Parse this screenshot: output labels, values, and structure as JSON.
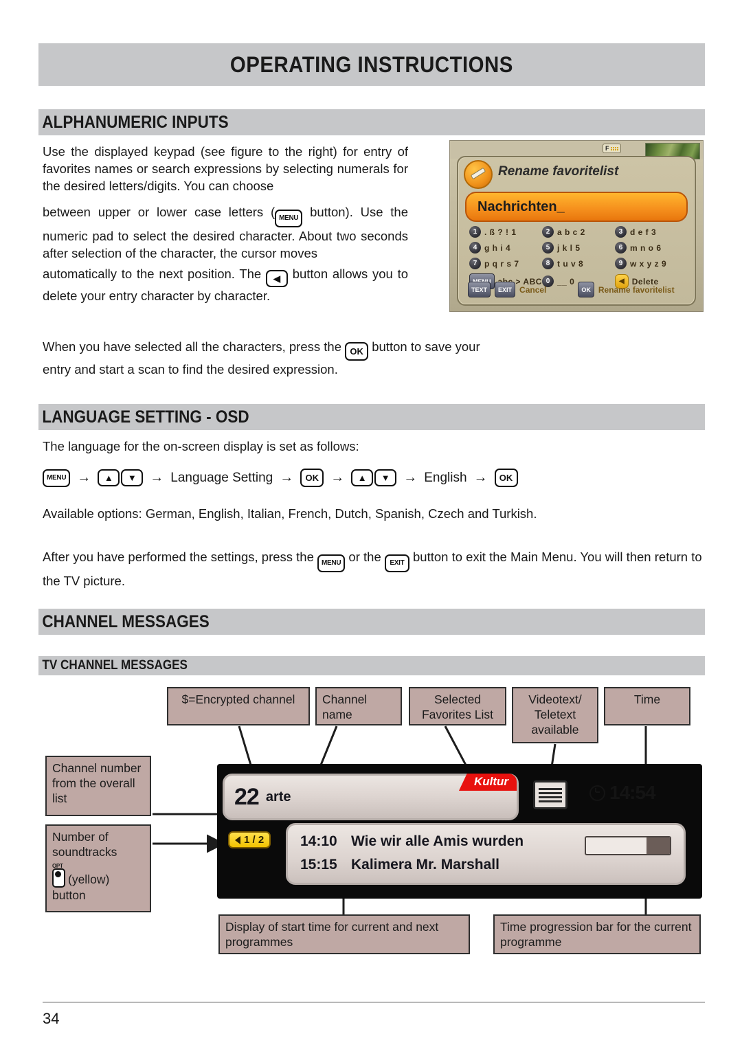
{
  "document": {
    "header_title": "OPERATING INSTRUCTIONS",
    "page_number": "34"
  },
  "sections": {
    "alphanumeric": {
      "heading": "ALPHANUMERIC INPUTS",
      "para1": "Use the displayed keypad (see figure to the right) for entry of favorites names or search expressions by selecting numerals for the desired letters/digits. You can choose",
      "para2_before": "between upper or lower case letters (",
      "para2_key": "MENU",
      "para2_after": " button). Use the numeric pad to select the desired character. About two seconds after selection of the character, the cursor moves",
      "para3_before": "automatically to the next position. The ",
      "para3_key": "◀",
      "para3_after": " button allows you to delete your entry character by character.",
      "para4_before": "When you have selected all the characters, press the ",
      "para4_key": "OK",
      "para4_after": " button to save your entry and start a scan to find the desired expression."
    },
    "language": {
      "heading": "LANGUAGE SETTING - OSD",
      "intro": "The language for the on-screen display is set as follows:",
      "sequence": [
        {
          "type": "key",
          "label": "MENU",
          "style": "menu"
        },
        {
          "type": "arrow",
          "label": "→"
        },
        {
          "type": "keypair",
          "labels": [
            "▲",
            "▼"
          ]
        },
        {
          "type": "arrow",
          "label": "→"
        },
        {
          "type": "text",
          "label": "Language Setting"
        },
        {
          "type": "arrow",
          "label": "→"
        },
        {
          "type": "key",
          "label": "OK",
          "style": "ok"
        },
        {
          "type": "arrow",
          "label": "→"
        },
        {
          "type": "keypair",
          "labels": [
            "▲",
            "▼"
          ]
        },
        {
          "type": "arrow",
          "label": "→"
        },
        {
          "type": "text",
          "label": "English"
        },
        {
          "type": "arrow",
          "label": "→"
        },
        {
          "type": "key",
          "label": "OK",
          "style": "ok"
        }
      ],
      "options": "Available options: German, English, Italian, French, Dutch, Spanish, Czech and Turkish.",
      "exit_before": "After you have performed the settings, press the ",
      "exit_key1": "MENU",
      "exit_mid": " or the ",
      "exit_key2": "EXIT",
      "exit_after": " button to exit the Main Menu. You will then return to the TV picture."
    },
    "channel_messages": {
      "heading": "CHANNEL MESSAGES",
      "subheading": "TV CHANNEL MESSAGES"
    }
  },
  "keypad_figure": {
    "title": "Rename favoritelist",
    "input_value": "Nachrichten_",
    "f_badge": "F",
    "keys": [
      {
        "btn": "1",
        "label": ". ß ? ! 1"
      },
      {
        "btn": "2",
        "label": "a b c 2"
      },
      {
        "btn": "3",
        "label": "d e f 3"
      },
      {
        "btn": "4",
        "label": "g h i 4"
      },
      {
        "btn": "5",
        "label": "j k l 5"
      },
      {
        "btn": "6",
        "label": "m n o 6"
      },
      {
        "btn": "7",
        "label": "p q r s 7"
      },
      {
        "btn": "8",
        "label": "t u v 8"
      },
      {
        "btn": "9",
        "label": "w x y z 9"
      },
      {
        "btn": "MENU",
        "label": "abc > ABC",
        "style": "menu"
      },
      {
        "btn": "0",
        "label": "__ 0"
      },
      {
        "btn": "◀",
        "label": "Delete",
        "style": "del"
      }
    ],
    "footer": {
      "cancel_keys": [
        "TEXT",
        "EXIT"
      ],
      "cancel_label": "Cancel",
      "ok_key": "OK",
      "ok_label": "Rename favoritelist"
    }
  },
  "diagram": {
    "callouts": {
      "encrypted": "$=Encrypted channel",
      "channel_name": "Channel name",
      "favorites": "Selected Favorites List",
      "videotext": "Videotext/ Teletext available",
      "time": "Time",
      "channel_number": "Channel number from the overall list",
      "soundtracks_line1": "Number of",
      "soundtracks_line2": "soundtracks",
      "soundtracks_opt": "OPT",
      "soundtracks_line3": "(yellow)",
      "soundtracks_line4": "button",
      "start_time": "Display of start time for current and next programmes",
      "progress": "Time progression bar for the current programme"
    },
    "tv_banner": {
      "channel_number": "22",
      "channel_name": "arte",
      "favorites_list": "Kultur",
      "clock": "14:54",
      "soundtrack_badge": "1 / 2",
      "programme_now_time": "14:10",
      "programme_now_title": "Wie wir alle Amis wurden",
      "programme_next_time": "15:15",
      "programme_next_title": "Kalimera Mr. Marshall",
      "progress_percent": 72
    }
  },
  "colors": {
    "band": "#c6c7c9",
    "callout": "#bfa8a4",
    "accent_orange": "#f6921e",
    "accent_red": "#e8110e",
    "accent_yellow": "#f2c200"
  }
}
